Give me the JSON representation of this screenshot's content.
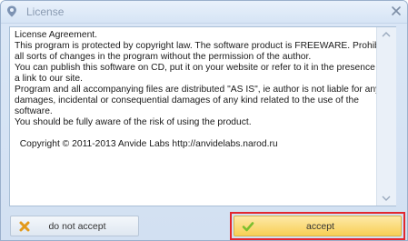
{
  "window": {
    "title": "License"
  },
  "license": {
    "text": "License Agreement.\nThis program is protected by copyright law. The software product is FREEWARE. Prohibits all sorts of changes in the program without the permission of the author.\nYou can publish this software on CD, put it on your website or refer to it in the presence of a link to our site.\nProgram and all accompanying files are distributed \"AS IS\", ie author is not liable for any damages, incidental or consequential damages of any kind related to the use of the software.\nYou should be fully aware of the risk of using the product.\n\n  Copyright © 2011-2013 Anvide Labs http://anvidelabs.narod.ru"
  },
  "buttons": {
    "decline_label": "do not accept",
    "accept_label": "accept"
  },
  "colors": {
    "accept_highlight": "#e2272f",
    "accept_bg": "#f8cf55",
    "decline_icon": "#e39a1b",
    "accept_icon": "#7cbf2f"
  },
  "icons": {
    "app": "pin-icon",
    "close": "close-icon",
    "decline": "x-mark-icon",
    "accept": "checkmark-icon"
  }
}
